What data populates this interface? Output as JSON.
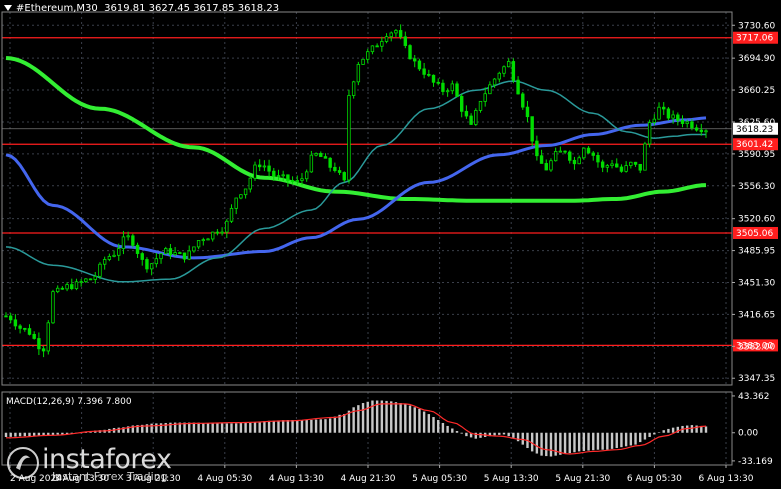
{
  "header": {
    "symbol": "#Ethereum,M30",
    "ohlc": "3619.81 3627.45 3617.85 3618.23"
  },
  "macd_label": "MACD(12,26,9) 7.396 7.800",
  "watermark": {
    "brand": "instaforex",
    "tagline": "Instant Forex Trading"
  },
  "colors": {
    "background": "#000000",
    "grid": "#3a3f4a",
    "candle": "#00dd00",
    "sma_long": "#33ee33",
    "sma_mid": "#4466ee",
    "sma_short": "#2a9a9a",
    "level": "#ff1e1e",
    "macd_signal": "#ff2a2a",
    "macd_hist": "#c8c8c8",
    "price_label_bg": "#ffffff"
  },
  "chart_data": [
    {
      "type": "candlestick",
      "title": "#Ethereum,M30",
      "ylim": [
        3340,
        3745
      ],
      "y_ticks": [
        "3730.60",
        "3694.90",
        "3660.25",
        "3625.60",
        "3590.95",
        "3556.30",
        "3520.60",
        "3485.95",
        "3451.30",
        "3416.65",
        "3382.00",
        "3347.35"
      ],
      "x_ticks": [
        "2 Aug 2024",
        "3 Aug 13:30",
        "3 Aug 21:30",
        "4 Aug 05:30",
        "4 Aug 13:30",
        "4 Aug 21:30",
        "5 Aug 05:30",
        "5 Aug 13:30",
        "5 Aug 21:30",
        "6 Aug 05:30",
        "6 Aug 13:30"
      ],
      "current_price": "3618.23",
      "levels": [
        {
          "value": 3717.06,
          "label": "3717.06"
        },
        {
          "value": 3601.42,
          "label": "3601.42"
        },
        {
          "value": 3505.06,
          "label": "3505.06"
        },
        {
          "value": 3383.0,
          "label": "3383.00"
        }
      ],
      "close_path": [
        [
          0,
          3415
        ],
        [
          4,
          3400
        ],
        [
          8,
          3380
        ],
        [
          10,
          3440
        ],
        [
          14,
          3448
        ],
        [
          18,
          3455
        ],
        [
          22,
          3480
        ],
        [
          26,
          3500
        ],
        [
          30,
          3470
        ],
        [
          34,
          3485
        ],
        [
          38,
          3480
        ],
        [
          42,
          3500
        ],
        [
          46,
          3510
        ],
        [
          50,
          3550
        ],
        [
          54,
          3580
        ],
        [
          58,
          3565
        ],
        [
          62,
          3560
        ],
        [
          66,
          3590
        ],
        [
          70,
          3575
        ],
        [
          72,
          3560
        ],
        [
          73,
          3655
        ],
        [
          75,
          3690
        ],
        [
          77,
          3700
        ],
        [
          79,
          3710
        ],
        [
          81,
          3722
        ],
        [
          83,
          3725
        ],
        [
          85,
          3705
        ],
        [
          87,
          3690
        ],
        [
          89,
          3680
        ],
        [
          91,
          3668
        ],
        [
          93,
          3660
        ],
        [
          95,
          3665
        ],
        [
          97,
          3640
        ],
        [
          99,
          3620
        ],
        [
          101,
          3650
        ],
        [
          103,
          3665
        ],
        [
          105,
          3680
        ],
        [
          107,
          3690
        ],
        [
          109,
          3660
        ],
        [
          111,
          3630
        ],
        [
          113,
          3585
        ],
        [
          115,
          3575
        ],
        [
          117,
          3590
        ],
        [
          119,
          3595
        ],
        [
          121,
          3580
        ],
        [
          123,
          3600
        ],
        [
          125,
          3590
        ],
        [
          127,
          3575
        ],
        [
          129,
          3582
        ],
        [
          131,
          3572
        ],
        [
          133,
          3580
        ],
        [
          135,
          3575
        ],
        [
          137,
          3625
        ],
        [
          139,
          3640
        ],
        [
          141,
          3632
        ],
        [
          143,
          3628
        ],
        [
          145,
          3625
        ],
        [
          147,
          3620
        ],
        [
          149,
          3618
        ]
      ],
      "series": [
        {
          "name": "",
          "color": "#33ee33",
          "points": [
            [
              0,
              3695
            ],
            [
              20,
              3640
            ],
            [
              40,
              3598
            ],
            [
              55,
              3565
            ],
            [
              70,
              3550
            ],
            [
              85,
              3542
            ],
            [
              100,
              3540
            ],
            [
              120,
              3540
            ],
            [
              130,
              3542
            ],
            [
              140,
              3550
            ],
            [
              149,
              3557
            ]
          ]
        },
        {
          "name": "",
          "color": "#4466ee",
          "points": [
            [
              0,
              3590
            ],
            [
              10,
              3535
            ],
            [
              25,
              3490
            ],
            [
              40,
              3478
            ],
            [
              55,
              3485
            ],
            [
              65,
              3500
            ],
            [
              75,
              3520
            ],
            [
              90,
              3560
            ],
            [
              105,
              3590
            ],
            [
              115,
              3600
            ],
            [
              125,
              3612
            ],
            [
              135,
              3622
            ],
            [
              145,
              3628
            ],
            [
              149,
              3630
            ]
          ]
        },
        {
          "name": "",
          "color": "#2a9a9a",
          "points": [
            [
              0,
              3490
            ],
            [
              10,
              3470
            ],
            [
              25,
              3452
            ],
            [
              35,
              3455
            ],
            [
              45,
              3478
            ],
            [
              55,
              3510
            ],
            [
              65,
              3530
            ],
            [
              72,
              3560
            ],
            [
              80,
              3600
            ],
            [
              90,
              3640
            ],
            [
              100,
              3660
            ],
            [
              108,
              3670
            ],
            [
              115,
              3660
            ],
            [
              125,
              3635
            ],
            [
              132,
              3615
            ],
            [
              138,
              3608
            ],
            [
              142,
              3610
            ],
            [
              146,
              3612
            ],
            [
              149,
              3612
            ]
          ]
        }
      ]
    },
    {
      "type": "macd",
      "title": "MACD(12,26,9) 7.396 7.800",
      "ylim": [
        -38,
        48
      ],
      "y_ticks": [
        "43.362",
        "0.00",
        "-33.169"
      ],
      "histogram": [
        [
          0,
          -5
        ],
        [
          4,
          -4
        ],
        [
          8,
          -3
        ],
        [
          12,
          -2
        ],
        [
          16,
          0
        ],
        [
          20,
          3
        ],
        [
          24,
          6
        ],
        [
          28,
          9
        ],
        [
          32,
          11
        ],
        [
          36,
          12
        ],
        [
          40,
          12
        ],
        [
          44,
          11
        ],
        [
          48,
          11
        ],
        [
          52,
          12
        ],
        [
          56,
          14
        ],
        [
          60,
          15
        ],
        [
          64,
          15
        ],
        [
          68,
          16
        ],
        [
          72,
          22
        ],
        [
          74,
          30
        ],
        [
          76,
          35
        ],
        [
          78,
          38
        ],
        [
          80,
          38
        ],
        [
          82,
          37
        ],
        [
          84,
          35
        ],
        [
          86,
          32
        ],
        [
          88,
          28
        ],
        [
          90,
          22
        ],
        [
          92,
          15
        ],
        [
          94,
          8
        ],
        [
          96,
          2
        ],
        [
          98,
          -4
        ],
        [
          100,
          -7
        ],
        [
          102,
          -5
        ],
        [
          104,
          -3
        ],
        [
          106,
          -2
        ],
        [
          108,
          -6
        ],
        [
          110,
          -14
        ],
        [
          112,
          -22
        ],
        [
          114,
          -27
        ],
        [
          116,
          -28
        ],
        [
          118,
          -26
        ],
        [
          120,
          -24
        ],
        [
          122,
          -22
        ],
        [
          124,
          -21
        ],
        [
          126,
          -20
        ],
        [
          128,
          -20
        ],
        [
          130,
          -18
        ],
        [
          132,
          -16
        ],
        [
          134,
          -14
        ],
        [
          136,
          -8
        ],
        [
          138,
          -2
        ],
        [
          140,
          3
        ],
        [
          142,
          6
        ],
        [
          144,
          8
        ],
        [
          146,
          9
        ],
        [
          148,
          8
        ],
        [
          149,
          7.4
        ]
      ],
      "signal": [
        [
          0,
          -6
        ],
        [
          10,
          -3
        ],
        [
          20,
          2
        ],
        [
          30,
          8
        ],
        [
          40,
          11
        ],
        [
          50,
          12
        ],
        [
          60,
          14
        ],
        [
          70,
          18
        ],
        [
          75,
          26
        ],
        [
          80,
          34
        ],
        [
          85,
          34
        ],
        [
          90,
          26
        ],
        [
          95,
          12
        ],
        [
          100,
          -2
        ],
        [
          105,
          -4
        ],
        [
          110,
          -8
        ],
        [
          115,
          -20
        ],
        [
          120,
          -25
        ],
        [
          125,
          -22
        ],
        [
          130,
          -20
        ],
        [
          135,
          -15
        ],
        [
          140,
          -4
        ],
        [
          145,
          5
        ],
        [
          149,
          7.8
        ]
      ]
    }
  ]
}
